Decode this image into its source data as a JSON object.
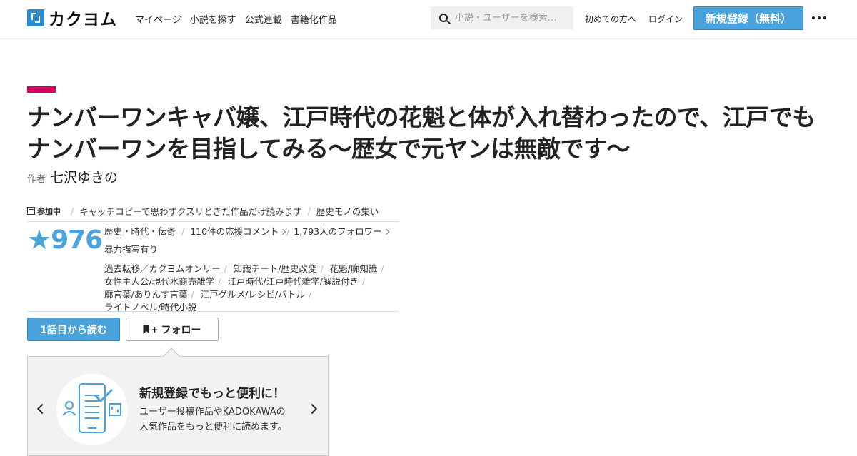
{
  "header": {
    "logo_text": "カクヨム",
    "nav": [
      "マイページ",
      "小説を探す",
      "公式連載",
      "書籍化作品"
    ],
    "search_placeholder": "小説・ユーザーを検索…",
    "first_time": "初めての方へ",
    "login": "ログイン",
    "signup": "新規登録（無料）"
  },
  "work": {
    "title": "ナンバーワンキャバ嬢、江戸時代の花魁と体が入れ替わったので、江戸でもナンバーワンを目指してみる～歴女で元ヤンは無敵です～",
    "author_label": "作者",
    "author_name": "七沢ゆきの",
    "event_label": "参加中",
    "events": [
      "キャッチコピーで思わずクスリときた作品だけ読みます",
      "歴史モノの集い"
    ],
    "stars": "976",
    "genre": "歴史・時代・伝奇",
    "comments": "110件の応援コメント",
    "followers": "1,793人のフォロワー",
    "warning": "暴力描写有り",
    "tags": [
      "過去転移／カクヨムオンリー",
      "知識チート/歴史改変",
      "花魁/廓知識",
      "女性主人公/現代水商売雑学",
      "江戸時代/江戸時代雑学/解説付き",
      "廓言葉/ありんす言葉",
      "江戸グルメ/レシピ/バトル",
      "ライトノベル/時代小説"
    ]
  },
  "actions": {
    "read_first": "1話目から読む",
    "follow": "フォロー",
    "follow_plus": "+"
  },
  "promo": {
    "title": "新規登録でもっと便利に！",
    "text_line1": "ユーザー投稿作品やKADOKAWAの",
    "text_line2": "人気作品をもっと便利に読めます。"
  },
  "colors": {
    "accent_blue": "#4aa3dd",
    "accent_magenta": "#d6005f"
  }
}
